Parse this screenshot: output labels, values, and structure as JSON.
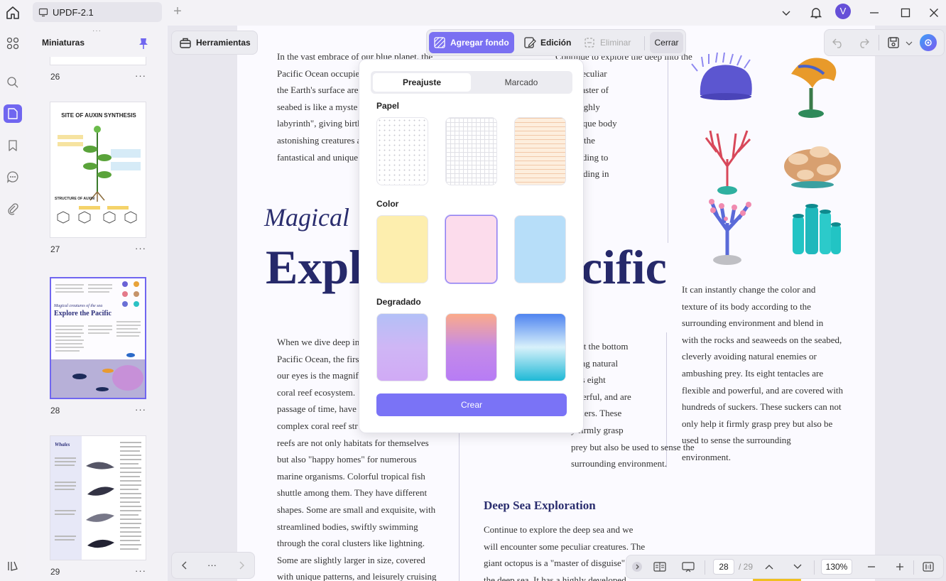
{
  "titlebar": {
    "tab_title": "UPDF-2.1",
    "avatar_letter": "V"
  },
  "thumbnails": {
    "title": "Miniaturas",
    "pages": [
      {
        "number": "26",
        "menu": "···"
      },
      {
        "number": "27",
        "menu": "···",
        "heading": "SITE OF AUXIN SYNTHESIS",
        "subheading": "STRUCTURE OF AUXIN"
      },
      {
        "number": "28",
        "menu": "···",
        "heading": "Explore the Pacific",
        "subheading": "Magical creatures of the sea"
      },
      {
        "number": "29",
        "menu": "···",
        "heading": "Whales"
      }
    ]
  },
  "toolbar": {
    "tools_label": "Herramientas",
    "add_background_label": "Agregar fondo",
    "edit_label": "Edición",
    "delete_label": "Eliminar",
    "close_label": "Cerrar"
  },
  "popup": {
    "tabs": [
      "Preajuste",
      "Marcado"
    ],
    "paper_label": "Papel",
    "color_label": "Color",
    "gradient_label": "Degradado",
    "create_label": "Crear",
    "colors": [
      "#fdeeae",
      "#fcdcec",
      "#b7def9"
    ],
    "gradients": [
      [
        "#b3c0f7",
        "#cfb6f5",
        "#d0aaf5"
      ],
      [
        "#fbaa8a",
        "#c58be7",
        "#b77cf5"
      ],
      [
        "#4f84f0",
        "#d8f1fb",
        "#1fb9d6"
      ]
    ]
  },
  "document": {
    "col1_top": [
      "In the vast embrace of our blue planet, the",
      "Pacific Ocean occupies",
      "the Earth's surface are",
      "seabed is like a myste",
      "labyrinth\", giving birth",
      "astonishing creatures a",
      "fantastical and unique"
    ],
    "col2_top": [
      "Continue to explore the deep into the",
      "some peculiar",
      "is a \"master of",
      "has a highly",
      "and unique body",
      "change the",
      "y according to",
      "nt, blending in"
    ],
    "magical_title": "Magical",
    "explore_left": "Expl",
    "explore_right": "cific",
    "col1_bottom": [
      "When we dive deep in",
      "Pacific Ocean, the firs",
      "our eyes is the magnif",
      "coral reef ecosystem.",
      "passage of time, have",
      "complex coral reef str",
      "reefs are not only habitats for themselves",
      "but also \"happy homes\" for numerous",
      "marine organisms. Colorful tropical fish",
      "shuttle among them. They have different",
      "shapes. Some are small and exquisite, with",
      "streamlined bodies, swiftly swimming",
      "through the coral clusters like lightning.",
      "Some are slightly larger in size, covered",
      "with unique patterns, and leisurely cruising"
    ],
    "col2_bottom": [
      "ls at the bottom",
      "iding natural",
      ". Its eight",
      "owerful, and are",
      "uckers. These",
      "y firmly grasp",
      "prey but also be used to sense the",
      "surrounding environment."
    ],
    "col3": [
      "It can instantly change the color and",
      "texture of its body according to the",
      "surrounding environment and blend in",
      "with the rocks and seaweeds on the seabed,",
      "cleverly avoiding natural enemies or",
      "ambushing prey. Its eight tentacles are",
      "flexible and powerful, and are covered with",
      "hundreds of suckers. These suckers can not",
      "only help it firmly grasp prey but also be",
      "used to sense the surrounding",
      "environment."
    ],
    "deep_sea_heading": "Deep Sea Exploration",
    "deep_sea_text": [
      "Continue to explore the deep sea and we",
      "will encounter some peculiar creatures. The",
      "giant octopus is a \"master of disguise\" in",
      "the deep sea. It has a highly developed"
    ]
  },
  "bottombar": {
    "current_page": "28",
    "total_pages": "/ 29",
    "zoom": "130%",
    "nav_dots": "···"
  }
}
